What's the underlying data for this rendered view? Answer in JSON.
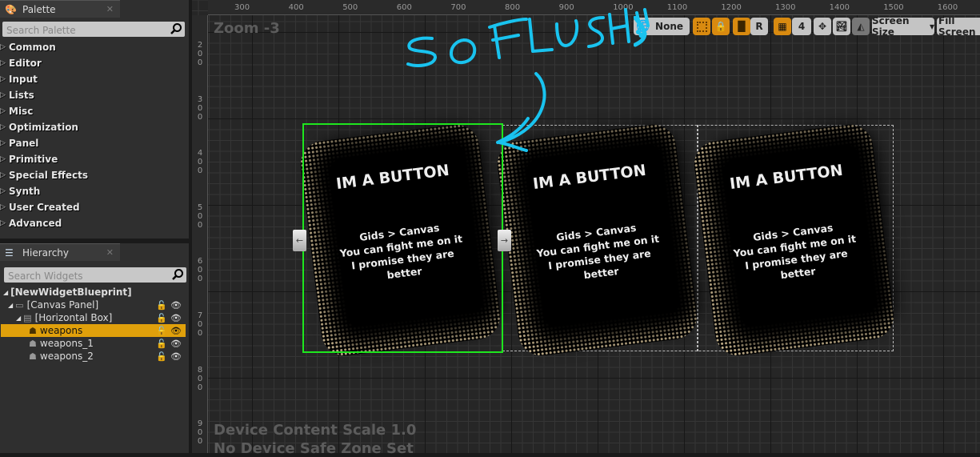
{
  "palette": {
    "tab": "Palette",
    "search_placeholder": "Search Palette",
    "categories": [
      "Common",
      "Editor",
      "Input",
      "Lists",
      "Misc",
      "Optimization",
      "Panel",
      "Primitive",
      "Special Effects",
      "Synth",
      "User Created",
      "Advanced"
    ]
  },
  "hierarchy": {
    "tab": "Hierarchy",
    "search_placeholder": "Search Widgets",
    "rows": [
      {
        "label": "[NewWidgetBlueprint]"
      },
      {
        "label": "[Canvas Panel]"
      },
      {
        "label": "[Horizontal Box]"
      },
      {
        "label": "weapons",
        "selected": true
      },
      {
        "label": "weapons_1"
      },
      {
        "label": "weapons_2"
      }
    ]
  },
  "designer": {
    "zoom": "Zoom -3",
    "scale": "Device Content Scale 1.0",
    "safe_zone": "No Device Safe Zone Set",
    "ruler_x": [
      "300",
      "400",
      "500",
      "600",
      "700",
      "800",
      "900",
      "1000",
      "1100",
      "1200",
      "1300",
      "1400",
      "1500",
      "1600"
    ],
    "ruler_y": [
      "2",
      "0",
      "0",
      "3",
      "0",
      "0",
      "4",
      "0",
      "0",
      "5",
      "0",
      "0",
      "6",
      "0",
      "0",
      "7",
      "0",
      "0",
      "8",
      "0",
      "0",
      "9",
      "0",
      "0"
    ],
    "toolbar": {
      "localization": "None",
      "snap_grid": "4",
      "r": "R",
      "screen_size": "Screen Size",
      "fill_screen": "Fill Screen"
    },
    "cards": [
      {
        "title": "IM A BUTTON",
        "body": [
          "Gids > Canvas",
          "You can fight me on it",
          "I promise they are",
          "better"
        ]
      },
      {
        "title": "IM A BUTTON",
        "body": [
          "Gids > Canvas",
          "You can fight me on it",
          "I promise they are",
          "better"
        ]
      },
      {
        "title": "IM A BUTTON",
        "body": [
          "Gids > Canvas",
          "You can fight me on it",
          "I promise they are",
          "better"
        ]
      }
    ],
    "annotation": "SO FLUSH!!",
    "annotation_color": "#19c3ef",
    "selection_color": "#1ee61e"
  }
}
